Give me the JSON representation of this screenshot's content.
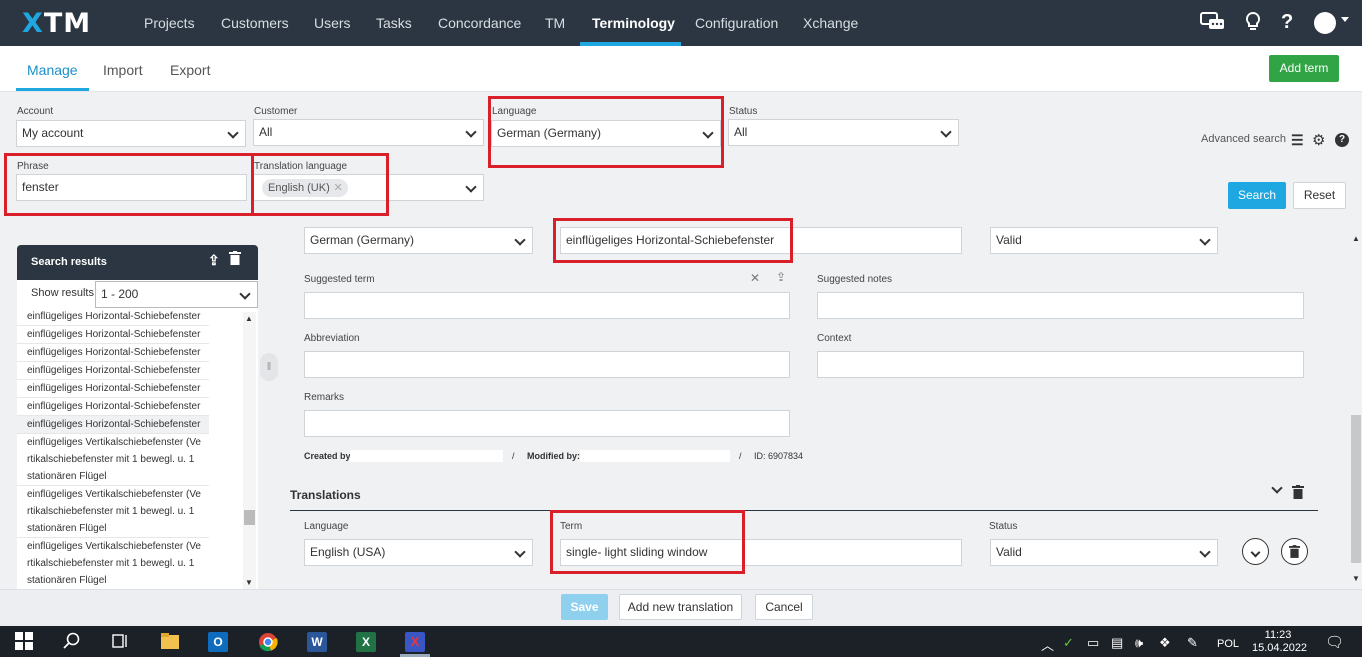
{
  "app": {
    "logo": "XTM"
  },
  "nav": {
    "items": [
      "Projects",
      "Customers",
      "Users",
      "Tasks",
      "Concordance",
      "TM",
      "Terminology",
      "Configuration",
      "Xchange"
    ],
    "active": "Terminology"
  },
  "subnav": {
    "tabs": [
      "Manage",
      "Import",
      "Export"
    ],
    "active": "Manage",
    "add_term": "Add term"
  },
  "filters": {
    "account_label": "Account",
    "account_value": "My account",
    "customer_label": "Customer",
    "customer_value": "All",
    "language_label": "Language",
    "language_value": "German (Germany)",
    "status_label": "Status",
    "status_value": "All",
    "phrase_label": "Phrase",
    "phrase_value": "fenster",
    "translation_language_label": "Translation language",
    "translation_language_chip": "English (UK)",
    "advanced_search": "Advanced search",
    "search_button": "Search",
    "reset_button": "Reset"
  },
  "search_results": {
    "title": "Search results",
    "show_results_label": "Show results:",
    "show_results_value": "1 - 200",
    "items": [
      [
        "einflügeliges Horizontal-Schiebefenster"
      ],
      [
        "einflügeliges Horizontal-Schiebefenster"
      ],
      [
        "einflügeliges Horizontal-Schiebefenster"
      ],
      [
        "einflügeliges Horizontal-Schiebefenster"
      ],
      [
        "einflügeliges Horizontal-Schiebefenster"
      ],
      [
        "einflügeliges Horizontal-Schiebefenster"
      ],
      [
        "einflügeliges Horizontal-Schiebefenster"
      ],
      [
        "einflügeliges Vertikalschiebefenster (Ve",
        "rtikalschiebefenster mit 1 bewegl. u. 1",
        "stationären Flügel"
      ],
      [
        "einflügeliges Vertikalschiebefenster (Ve",
        "rtikalschiebefenster mit 1 bewegl. u. 1",
        "stationären Flügel"
      ],
      [
        "einflügeliges Vertikalschiebefenster (Ve",
        "rtikalschiebefenster mit 1 bewegl. u. 1",
        "stationären Flügel"
      ]
    ]
  },
  "term": {
    "language_value": "German (Germany)",
    "term_value": "einflügeliges Horizontal-Schiebefenster",
    "status_value": "Valid",
    "suggested_term_label": "Suggested term",
    "suggested_notes_label": "Suggested notes",
    "abbreviation_label": "Abbreviation",
    "context_label": "Context",
    "remarks_label": "Remarks",
    "created_by_label": "Created by",
    "modified_by_label": "Modified by:",
    "separator": "/",
    "id_text": "ID: 6907834"
  },
  "translations": {
    "title": "Translations",
    "language_label": "Language",
    "language_value": "English (USA)",
    "term_label": "Term",
    "term_value": "single- light sliding window",
    "status_label": "Status",
    "status_value": "Valid"
  },
  "footer": {
    "save": "Save",
    "add_new_translation": "Add new translation",
    "cancel": "Cancel"
  },
  "taskbar": {
    "lang": "POL",
    "time": "11:23",
    "date": "15.04.2022"
  }
}
